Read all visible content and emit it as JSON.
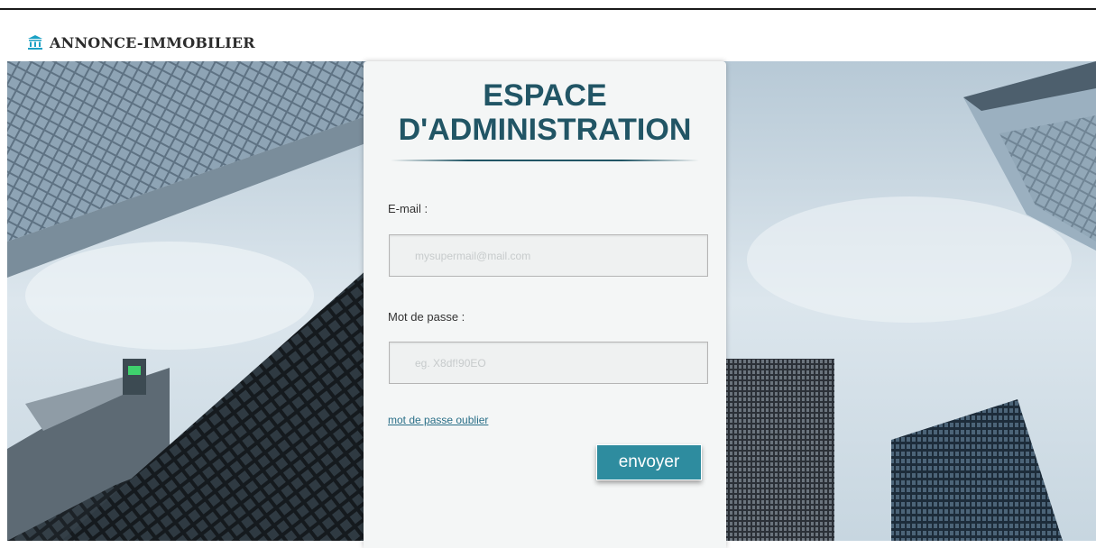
{
  "brand": {
    "icon": "bank-building-icon",
    "name": "ANNONCE-IMMOBILIER"
  },
  "login": {
    "title_line1": "ESPACE",
    "title_line2": "D'ADMINISTRATION",
    "email_label": "E-mail :",
    "email_placeholder": "mysupermail@mail.com",
    "email_value": "",
    "password_label": "Mot de passe :",
    "password_placeholder": "eg. X8df!90EO",
    "password_value": "",
    "forgot_link": "mot de passe oublier",
    "submit_label": "envoyer"
  },
  "colors": {
    "accent": "#2e8c9f",
    "title": "#215565",
    "link": "#2a6f88",
    "brand_icon": "#1aa0c4"
  }
}
